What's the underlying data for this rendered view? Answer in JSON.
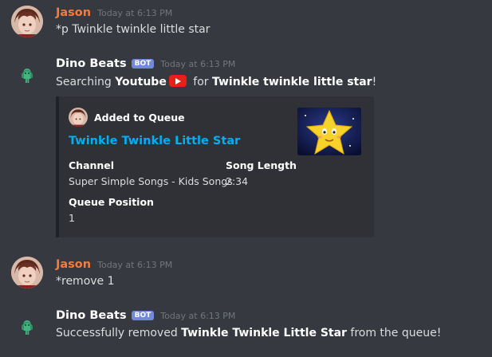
{
  "messages": [
    {
      "author": "Jason",
      "timestamp": "Today at 6:13 PM",
      "text": "*p Twinkle twinkle little star"
    },
    {
      "author": "Dino Beats",
      "bot_tag": "BOT",
      "timestamp": "Today at 6:13 PM",
      "text_prefix": "Searching ",
      "text_source": "Youtube",
      "text_mid": " for ",
      "text_query": "Twinkle twinkle little star",
      "text_suffix": "!",
      "source_icon": "youtube-icon",
      "embed": {
        "author_name": "Added to Queue",
        "title": "Twinkle Twinkle Little Star",
        "fields": [
          {
            "name": "Channel",
            "value": "Super Simple Songs - Kids Songs"
          },
          {
            "name": "Song Length",
            "value": "2:34"
          },
          {
            "name": "Queue Position",
            "value": "1"
          }
        ],
        "thumbnail": "star-video-thumbnail"
      }
    },
    {
      "author": "Jason",
      "timestamp": "Today at 6:13 PM",
      "text": "*remove 1"
    },
    {
      "author": "Dino Beats",
      "bot_tag": "BOT",
      "timestamp": "Today at 6:13 PM",
      "text_prefix": "Successfully removed ",
      "text_item": "Twinkle Twinkle Little Star",
      "text_suffix": " from the queue!"
    }
  ],
  "colors": {
    "background": "#36393f",
    "embed_background": "#2f3136",
    "jason_name": "#f47b3e",
    "bot_tag": "#7289da",
    "link": "#00b0f4",
    "timestamp": "#72767d"
  }
}
